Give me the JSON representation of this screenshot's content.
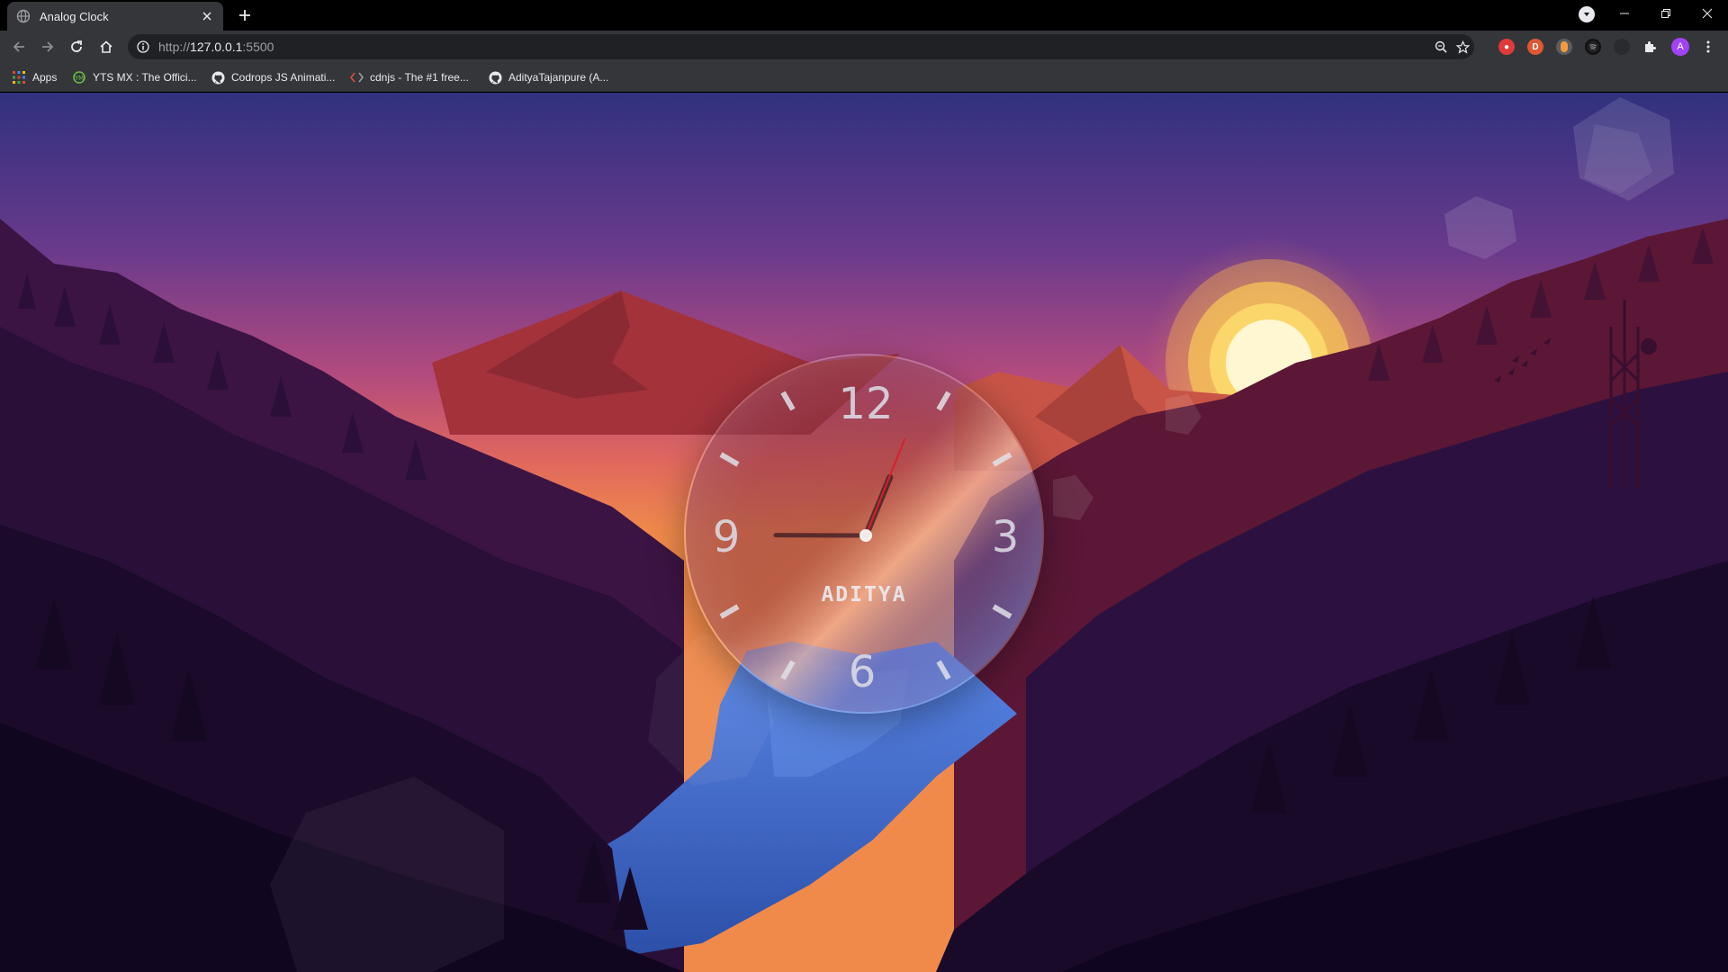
{
  "browser": {
    "tab_title": "Analog Clock",
    "url_scheme": "http://",
    "url_host": "127.0.0.1",
    "url_port": ":5500",
    "profile_initial": "A"
  },
  "bookmarks": [
    {
      "label": "Apps",
      "icon": "apps-grid-icon"
    },
    {
      "label": "YTS MX : The Offici...",
      "icon": "yts-icon"
    },
    {
      "label": "Codrops JS Animati...",
      "icon": "github-icon"
    },
    {
      "label": "cdnjs - The #1 free...",
      "icon": "code-icon"
    },
    {
      "label": "AdityaTajanpure (A...",
      "icon": "github-icon"
    }
  ],
  "clock": {
    "numbers": {
      "twelve": "12",
      "three": "3",
      "six": "6",
      "nine": "9"
    },
    "label": "ADITYA",
    "time": {
      "hour": 12,
      "minute": 45,
      "second": 2
    }
  },
  "colors": {
    "sky_top": "#3a2e86",
    "sky_mid": "#b24a7e",
    "sky_horizon": "#f08a4b",
    "sun": "#fff3c4",
    "river": "#3f6fd0",
    "second_hand": "#d8202a"
  }
}
